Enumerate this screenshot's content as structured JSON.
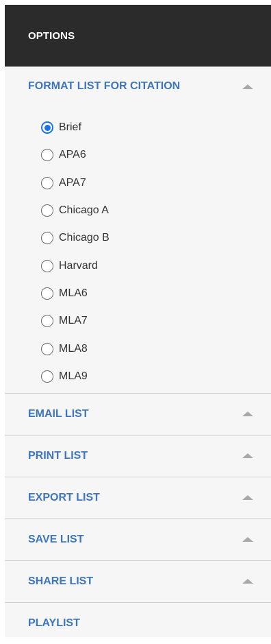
{
  "header": {
    "title": "OPTIONS"
  },
  "format_section": {
    "label": "FORMAT LIST FOR CITATION",
    "selected": "Brief",
    "options": [
      "Brief",
      "APA6",
      "APA7",
      "Chicago A",
      "Chicago B",
      "Harvard",
      "MLA6",
      "MLA7",
      "MLA8",
      "MLA9"
    ]
  },
  "sections": [
    {
      "label": "EMAIL LIST"
    },
    {
      "label": "PRINT LIST"
    },
    {
      "label": "EXPORT LIST"
    },
    {
      "label": "SAVE LIST"
    },
    {
      "label": "SHARE LIST"
    },
    {
      "label": "PLAYLIST"
    }
  ],
  "colors": {
    "header_bg": "#2b2b2b",
    "link": "#3f75bd",
    "radio_checked": "#1a73e8"
  }
}
